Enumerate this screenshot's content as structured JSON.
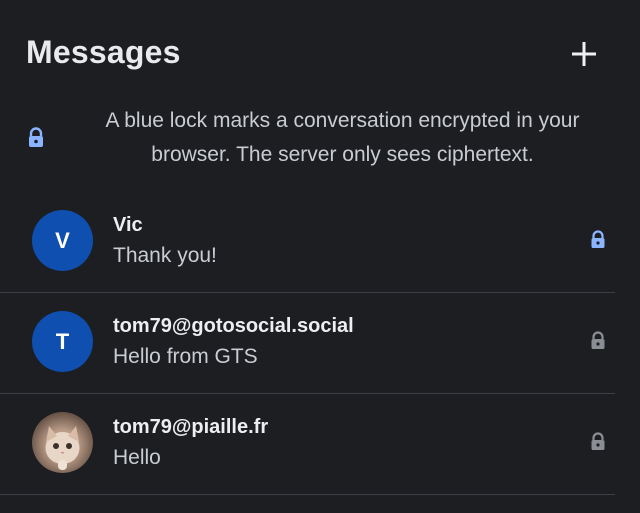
{
  "header": {
    "title": "Messages",
    "new_icon": "plus-icon"
  },
  "notice": {
    "icon": "lock-icon",
    "text": "A blue lock marks a conversation encrypted in your browser. The server only sees ciphertext."
  },
  "colors": {
    "background": "#1c1e22",
    "accent_blue": "#0f4fb0",
    "lock_encrypted": "#8ab4ff",
    "lock_plain": "#8a8d93",
    "divider": "#3b3e45"
  },
  "conversations": [
    {
      "initial": "V",
      "name": "Vic",
      "preview": "Thank you!",
      "encrypted": true
    },
    {
      "initial": "T",
      "name": "tom79@gotosocial.social",
      "preview": "Hello from GTS",
      "encrypted": false
    },
    {
      "initial": "",
      "name": "tom79@piaille.fr",
      "preview": "Hello",
      "encrypted": false,
      "avatar": "cat-photo"
    }
  ]
}
